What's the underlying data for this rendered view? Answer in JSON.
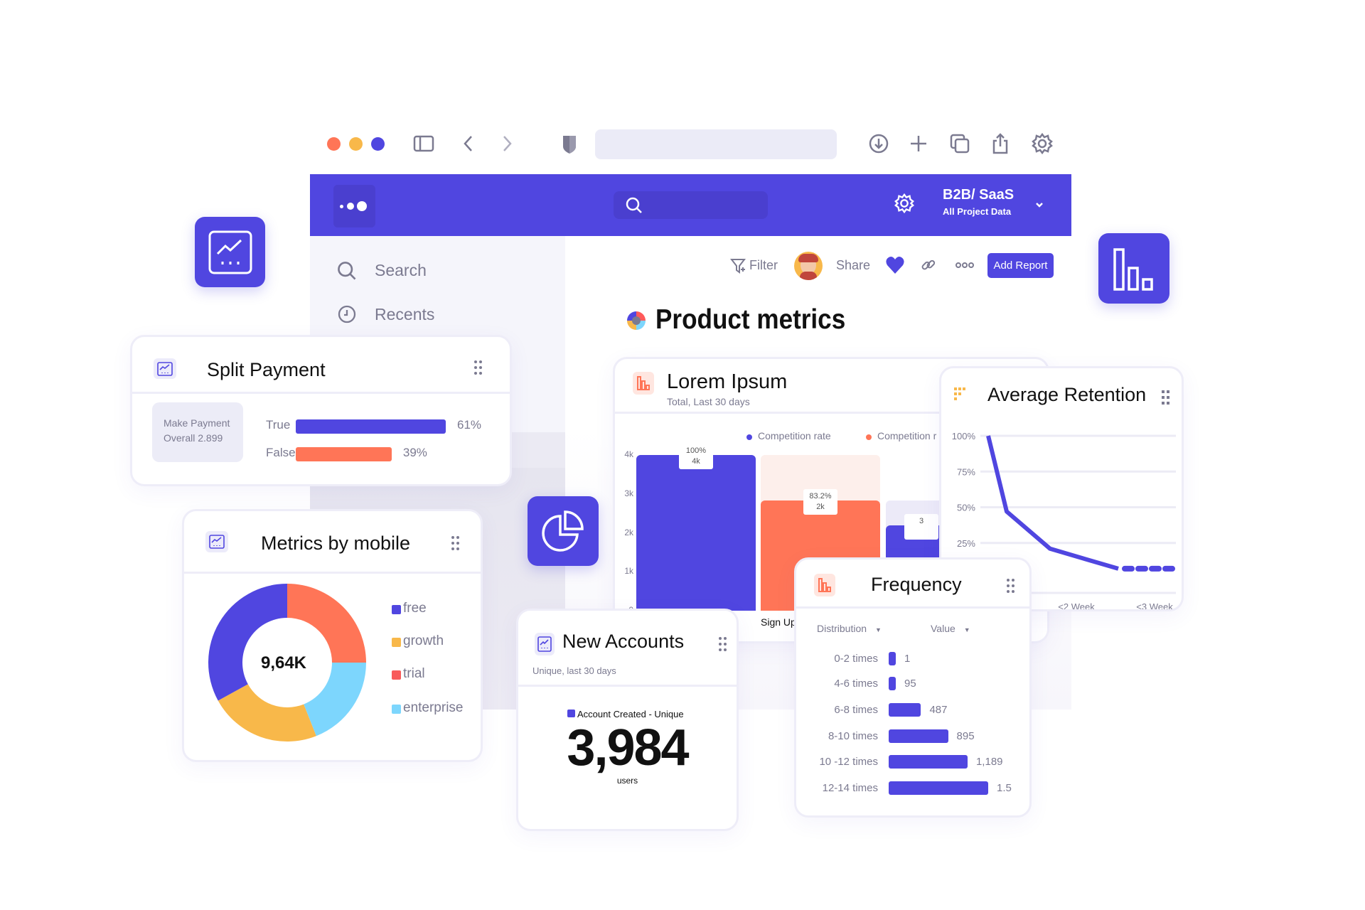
{
  "browser": {
    "address_value": "",
    "icons": [
      "sidebar-toggle-icon",
      "back-icon",
      "forward-icon",
      "shield-icon",
      "download-icon",
      "plus-icon",
      "tabs-icon",
      "share-icon",
      "gear-icon"
    ]
  },
  "app": {
    "colors": {
      "primary": "#5046e0",
      "orange": "#ff7557",
      "yellow": "#f8b84a",
      "cyan": "#7dd6fd",
      "red": "#f85a5a"
    },
    "header": {
      "search_placeholder": "",
      "project_name": "B2B/ SaaS",
      "project_scope": "All Project Data"
    },
    "sidebar": {
      "items": [
        {
          "label": "Search",
          "icon": "search-icon"
        },
        {
          "label": "Recents",
          "icon": "clock-icon"
        }
      ]
    },
    "toolbar": {
      "filter": "Filter",
      "share": "Share",
      "add_report": "Add Report"
    },
    "page_title": "Product metrics"
  },
  "cards": {
    "split_payment": {
      "title": "Split Payment",
      "summary_line1": "Make Payment",
      "summary_line2": "Overall 2.899"
    },
    "metrics_mobile": {
      "title": "Metrics by mobile",
      "center_value": "9,64K"
    },
    "lorem": {
      "title": "Lorem Ipsum",
      "subtitle": "Total, Last 30 days"
    },
    "retention": {
      "title": "Average Retention"
    },
    "frequency": {
      "title": "Frequency",
      "col1": "Distribution",
      "col2": "Value"
    },
    "new_accounts": {
      "title": "New Accounts",
      "subtitle": "Unique, last 30 days",
      "legend": "Account Created - Unique",
      "value": "3,984",
      "unit": "users"
    }
  },
  "chart_data": [
    {
      "type": "bar",
      "id": "split_payment",
      "categories": [
        "True",
        "False"
      ],
      "values": [
        61,
        39
      ],
      "value_labels": [
        "61%",
        "39%"
      ],
      "colors": [
        "#5046e0",
        "#ff7557"
      ]
    },
    {
      "type": "pie",
      "id": "metrics_mobile",
      "categories": [
        "free",
        "growth",
        "trial",
        "enterprise"
      ],
      "legend_colors": [
        "#5046e0",
        "#f8b84a",
        "#f85a5a",
        "#7dd6fd"
      ],
      "slices": [
        {
          "color": "#ff7557",
          "value": 25
        },
        {
          "color": "#7dd6fd",
          "value": 19
        },
        {
          "color": "#f8b84a",
          "value": 23
        },
        {
          "color": "#5046e0",
          "value": 33
        }
      ],
      "legend": "right"
    },
    {
      "type": "bar",
      "id": "lorem",
      "legend": [
        "Competition rate",
        "Competition r"
      ],
      "legend_colors": [
        "#5046e0",
        "#ff7557"
      ],
      "yticks": [
        "4k",
        "3k",
        "2k",
        "1k",
        "0"
      ],
      "ylim": [
        0,
        4
      ],
      "bars": [
        {
          "category": "",
          "value": 4,
          "background": 4,
          "color": "#5046e0",
          "label_top": "100%",
          "label_bottom": "4k"
        },
        {
          "category": "Sign Up",
          "value": 2.84,
          "background": 4,
          "color": "#ff7557",
          "label_top": "83.2%",
          "label_bottom": "2k"
        },
        {
          "category": "",
          "value": 2.2,
          "background": 2.84,
          "color": "#5046e0",
          "label_top": "3",
          "label_bottom": ""
        }
      ]
    },
    {
      "type": "line",
      "id": "retention",
      "yticks": [
        "100%",
        "75%",
        "50%",
        "25%"
      ],
      "ylim": [
        0,
        100
      ],
      "xticks": [
        "<2 Week",
        "<3 Week"
      ],
      "points": [
        100,
        47,
        21,
        7
      ],
      "dashed_tail": 7,
      "grid": true
    },
    {
      "type": "bar",
      "id": "frequency",
      "orientation": "horizontal",
      "categories": [
        "0-2 times",
        "4-6 times",
        "6-8 times",
        "8-10 times",
        "10 -12 times",
        "12-14 times"
      ],
      "values": [
        1,
        95,
        487,
        895,
        1189,
        1500
      ],
      "value_labels": [
        "1",
        "95",
        "487",
        "895",
        "1,189",
        "1.5"
      ]
    }
  ]
}
